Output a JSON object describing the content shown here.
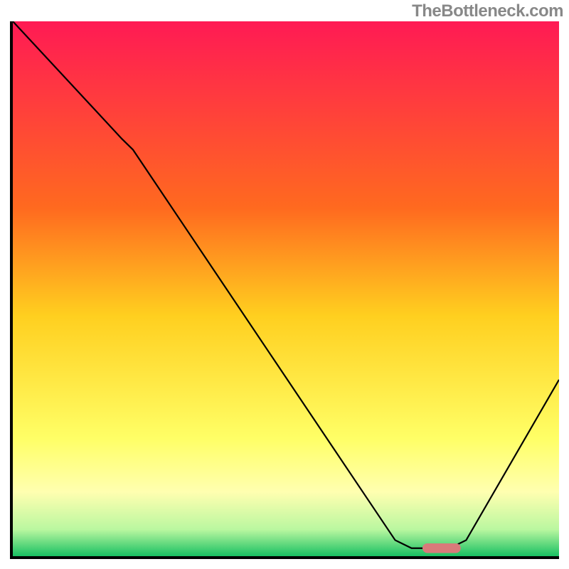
{
  "watermark": "TheBottleneck.com",
  "chart_data": {
    "type": "line",
    "title": "",
    "xlabel": "",
    "ylabel": "",
    "xlim": [
      0,
      100
    ],
    "ylim": [
      0,
      100
    ],
    "gradient_stops": [
      {
        "offset": 0,
        "color": "#ff1a54"
      },
      {
        "offset": 35,
        "color": "#ff6a1f"
      },
      {
        "offset": 55,
        "color": "#ffcf1f"
      },
      {
        "offset": 78,
        "color": "#ffff66"
      },
      {
        "offset": 88,
        "color": "#ffffb0"
      },
      {
        "offset": 95,
        "color": "#baf7a0"
      },
      {
        "offset": 100,
        "color": "#18c062"
      }
    ],
    "series": [
      {
        "name": "bottleneck-curve",
        "color": "#000000",
        "points": [
          {
            "x": 0,
            "y": 100
          },
          {
            "x": 20,
            "y": 78
          },
          {
            "x": 22,
            "y": 76
          },
          {
            "x": 70,
            "y": 3
          },
          {
            "x": 73,
            "y": 1.5
          },
          {
            "x": 80,
            "y": 1.5
          },
          {
            "x": 83,
            "y": 3
          },
          {
            "x": 100,
            "y": 33
          }
        ]
      }
    ],
    "marker": {
      "name": "optimal-range",
      "color": "#d97a7a",
      "x_start": 75,
      "x_end": 82,
      "y": 1.5,
      "thickness_pct": 1.8
    }
  }
}
